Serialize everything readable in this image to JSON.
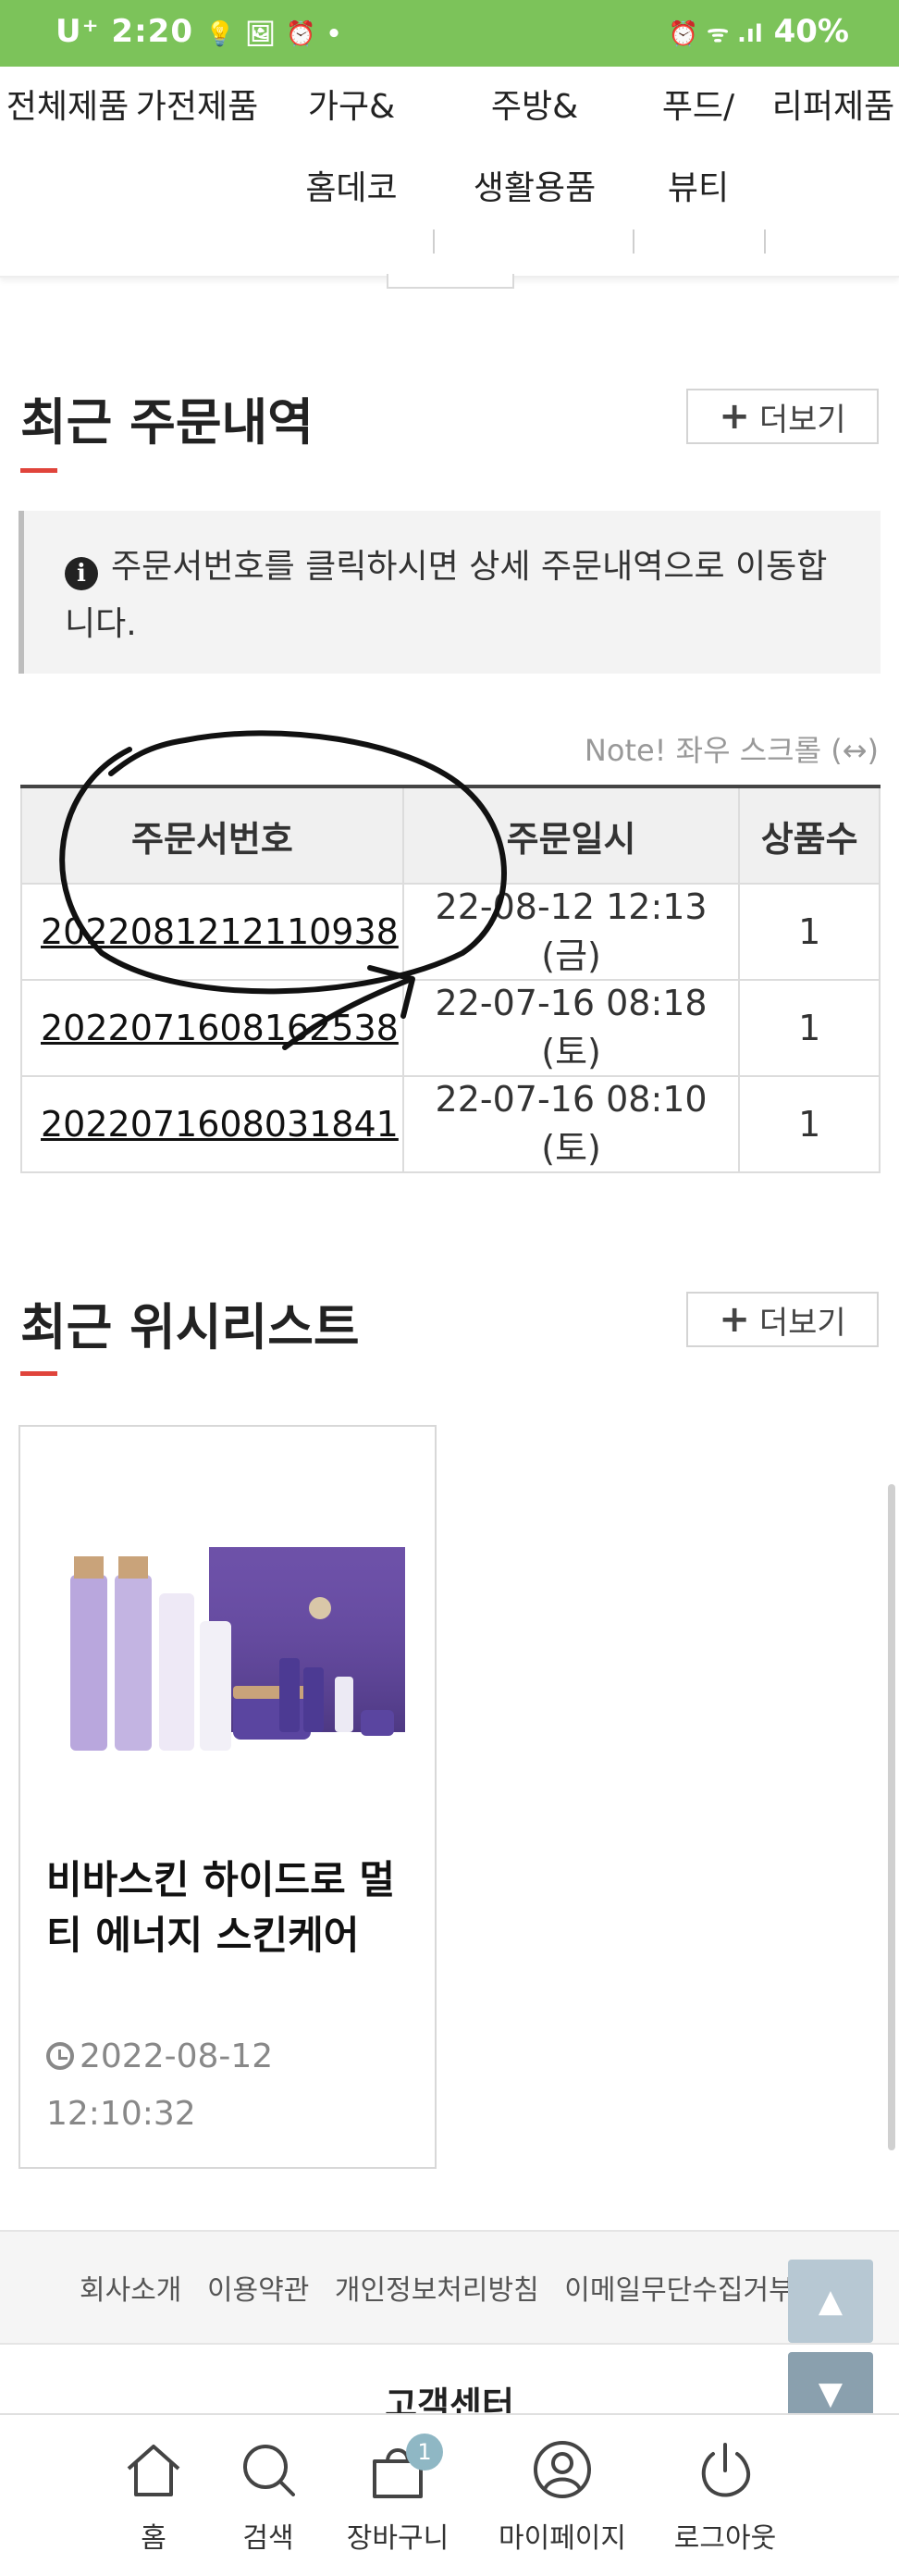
{
  "status_bar": {
    "carrier": "U⁺",
    "time": "2:20",
    "left_icons": "💡 🖼 ⏰ •",
    "right_icons": "⏰ ᯤ .ıl",
    "battery": "40%"
  },
  "category_nav": {
    "items": [
      {
        "line1": "전체제품",
        "line2": ""
      },
      {
        "line1": "가전제품",
        "line2": ""
      },
      {
        "line1": "가구&",
        "line2": "홈데코"
      },
      {
        "line1": "주방&",
        "line2": "생활용품"
      },
      {
        "line1": "푸드/",
        "line2": "뷰티"
      },
      {
        "line1": "리퍼제품",
        "line2": ""
      }
    ]
  },
  "recent_orders": {
    "title": "최근 주문내역",
    "more_label": "더보기",
    "notice": "주문서번호를 클릭하시면 상세 주문내역으로 이동합니다.",
    "scroll_note": "Note! 좌우 스크롤 (↔)",
    "columns": [
      "주문서번호",
      "주문일시",
      "상품수"
    ],
    "rows": [
      {
        "order_no": "2022081212110938",
        "date": "22-08-12 12:13 (금)",
        "qty": "1"
      },
      {
        "order_no": "2022071608162538",
        "date": "22-07-16 08:18 (토)",
        "qty": "1"
      },
      {
        "order_no": "2022071608031841",
        "date": "22-07-16 08:10 (토)",
        "qty": "1"
      }
    ]
  },
  "wishlist": {
    "title": "최근 위시리스트",
    "more_label": "더보기",
    "item": {
      "name": "비바스킨 하이드로 멀티 에너지 스킨케어",
      "date_line1": "2022-08-12",
      "date_line2": "12:10:32"
    }
  },
  "footer": {
    "links": [
      "회사소개",
      "이용약관",
      "개인정보처리방침",
      "이메일무단수집거부"
    ],
    "cs_title": "고객센터"
  },
  "tabbar": {
    "items": [
      {
        "label": "홈",
        "icon": "home-icon"
      },
      {
        "label": "검색",
        "icon": "search-icon"
      },
      {
        "label": "장바구니",
        "icon": "cart-icon",
        "badge": "1"
      },
      {
        "label": "마이페이지",
        "icon": "user-icon"
      },
      {
        "label": "로그아웃",
        "icon": "power-icon"
      }
    ]
  },
  "colors": {
    "status_bar": "#7cc35a",
    "accent_red": "#e0443b",
    "float_button": "#8aa0ae"
  }
}
